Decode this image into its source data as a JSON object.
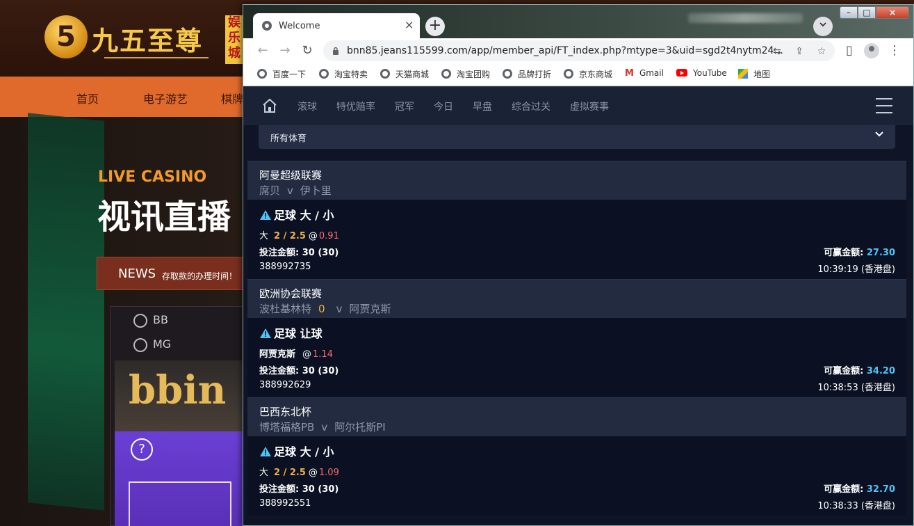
{
  "background_site": {
    "logo_digit": "5",
    "logo_text": "九五至尊",
    "logo_sub": "娱乐城",
    "nav": [
      "首页",
      "电子游艺",
      "棋牌"
    ],
    "live_label": "LIVE CASINO",
    "hero_title": "视讯直播",
    "news_label": "NEWS",
    "news_text": "存取款的办理时间！",
    "games": [
      "BB",
      "MG"
    ],
    "bbin_text": "bbin",
    "help_icon_text": "?"
  },
  "browser": {
    "tab_title": "Welcome",
    "tab_close": "×",
    "new_tab": "+",
    "url": "bnn85.jeans115599.com/app/member_api/FT_index.php?mtype=3&uid=sgd2t4nytm24...",
    "bookmarks": [
      {
        "label": "百度一下",
        "icon": "globe-icon"
      },
      {
        "label": "淘宝特卖",
        "icon": "globe-icon"
      },
      {
        "label": "天猫商城",
        "icon": "globe-icon"
      },
      {
        "label": "淘宝团购",
        "icon": "globe-icon"
      },
      {
        "label": "品牌打折",
        "icon": "globe-icon"
      },
      {
        "label": "京东商城",
        "icon": "globe-icon"
      },
      {
        "label": "Gmail",
        "icon": "gmail-icon"
      },
      {
        "label": "YouTube",
        "icon": "youtube-icon"
      },
      {
        "label": "地图",
        "icon": "maps-icon"
      }
    ]
  },
  "page": {
    "nav": [
      "滚球",
      "特优赔率",
      "冠军",
      "今日",
      "早盘",
      "综合过关",
      "虚拟赛事"
    ],
    "sport_filter": "所有体育",
    "bets": [
      {
        "league": "阿曼超级联赛",
        "home": "席贝",
        "vs": "v",
        "score": "",
        "away": "伊卜里",
        "type": "足球 大 / 小",
        "pick": "大",
        "line": "2 / 2.5",
        "at": "@",
        "odds": "0.91",
        "stake_label": "投注金额:",
        "stake": "30 (30)",
        "win_label": "可赢金额:",
        "win": "27.30",
        "id": "388992735",
        "time": "10:39:19 (香港盘)"
      },
      {
        "league": "欧洲协会联赛",
        "home": "波杜基林特",
        "vs": "v",
        "score": "0",
        "away": "阿贾克斯",
        "type": "足球 让球",
        "pick": "阿贾克斯",
        "line": "",
        "at": "@",
        "odds": "1.14",
        "stake_label": "投注金额:",
        "stake": "30 (30)",
        "win_label": "可赢金额:",
        "win": "34.20",
        "id": "388992629",
        "time": "10:38:53 (香港盘)"
      },
      {
        "league": "巴西东北杯",
        "home": "博塔福格PB",
        "vs": "v",
        "score": "",
        "away": "阿尔托斯PI",
        "type": "足球 大 / 小",
        "pick": "大",
        "line": "2 / 2.5",
        "at": "@",
        "odds": "1.09",
        "stake_label": "投注金额:",
        "stake": "30 (30)",
        "win_label": "可赢金额:",
        "win": "32.70",
        "id": "388992551",
        "time": "10:38:33 (香港盘)"
      }
    ]
  }
}
